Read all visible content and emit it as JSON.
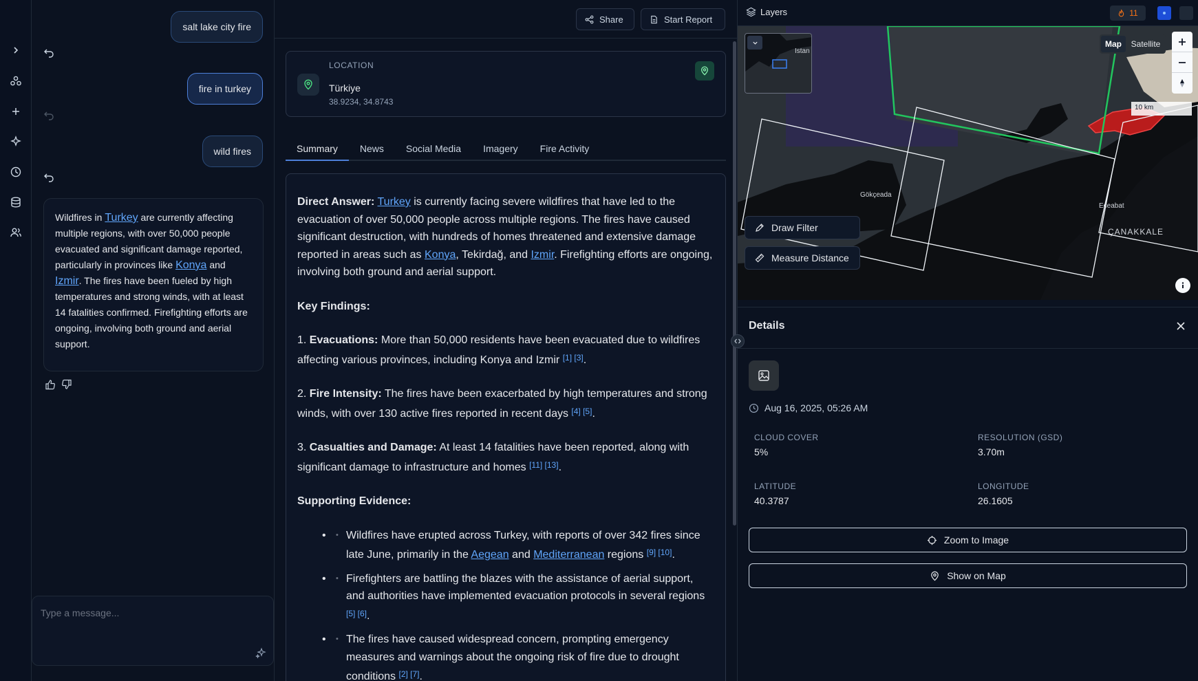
{
  "chat": {
    "user_messages": [
      "salt lake city fire",
      "fire in turkey",
      "wild fires"
    ],
    "assistant": {
      "t1": "Wildfires in ",
      "link1": "Turkey",
      "t2": " are currently affecting multiple regions, with over 50,000 people evacuated and significant damage reported, particularly in provinces like ",
      "link2": "Konya",
      "t3": " and ",
      "link3": "Izmir",
      "t4": ". The fires have been fueled by high temperatures and strong winds, with at least 14 fatalities confirmed. Firefighting efforts are ongoing, involving both ground and aerial support."
    },
    "composer_placeholder": "Type a message..."
  },
  "topbar": {
    "share": "Share",
    "start_report": "Start Report"
  },
  "location": {
    "label": "LOCATION",
    "name": "Türkiye",
    "coords": "38.9234, 34.8743"
  },
  "tabs": [
    "Summary",
    "News",
    "Social Media",
    "Imagery",
    "Fire Activity"
  ],
  "content": {
    "direct_label": "Direct Answer:",
    "direct_link": "Turkey",
    "direct_t1": " is currently facing severe wildfires that have led to the evacuation of over 50,000 people across multiple regions. The fires have caused significant destruction, with hundreds of homes threatened and extensive damage reported in areas such as ",
    "direct_link2": "Konya",
    "direct_t2": ", Tekirdağ, and ",
    "direct_link3": "Izmir",
    "direct_t3": ". Firefighting efforts are ongoing, involving both ground and aerial support.",
    "key_findings": "Key Findings:",
    "f1_num": "1. ",
    "f1_label": "Evacuations:",
    "f1_text": " More than 50,000 residents have been evacuated due to wildfires affecting various provinces, including Konya and Izmir ",
    "f1_cite": "[1] [3]",
    "f2_num": "2. ",
    "f2_label": "Fire Intensity:",
    "f2_text": " The fires have been exacerbated by high temperatures and strong winds, with over 130 active fires reported in recent days ",
    "f2_cite": "[4] [5]",
    "f3_num": "3. ",
    "f3_label": "Casualties and Damage:",
    "f3_text": " At least 14 fatalities have been reported, along with significant damage to infrastructure and homes ",
    "f3_cite": "[11] [13]",
    "supporting": "Supporting Evidence:",
    "b1_t1": "Wildfires have erupted across Turkey, with reports of over 342 fires since late June, primarily in the ",
    "b1_link1": "Aegean",
    "b1_t2": " and ",
    "b1_link2": "Mediterranean",
    "b1_t3": " regions ",
    "b1_cite": "[9] [10]",
    "b2_text": "Firefighters are battling the blazes with the assistance of aerial support, and authorities have implemented evacuation protocols in several regions ",
    "b2_cite": "[5] [6]",
    "b3_text": "The fires have caused widespread concern, prompting emergency measures and warnings about the ongoing risk of fire due to drought conditions ",
    "b3_cite": "[2] [7]",
    "period": "."
  },
  "layers": {
    "label": "Layers",
    "fire_count": "11"
  },
  "map": {
    "toggle_map": "Map",
    "toggle_satellite": "Satellite",
    "scale": "10 km",
    "labels": {
      "gokceada": "Gökçeada",
      "eceabat": "Eceabat",
      "canakkale": "ÇANAKKALE",
      "istanbul_partial": "Istan"
    },
    "draw_filter": "Draw Filter",
    "measure_distance": "Measure Distance",
    "colors": {
      "footprint_selected": "#22c55e",
      "fire": "#ef4444"
    }
  },
  "details": {
    "title": "Details",
    "date": "Aug 16, 2025, 05:26 AM",
    "cloud_cover_label": "CLOUD COVER",
    "cloud_cover": "5%",
    "resolution_label": "RESOLUTION (GSD)",
    "resolution": "3.70m",
    "latitude_label": "LATITUDE",
    "latitude": "40.3787",
    "longitude_label": "LONGITUDE",
    "longitude": "26.1605",
    "zoom_btn": "Zoom to Image",
    "show_btn": "Show on Map"
  }
}
